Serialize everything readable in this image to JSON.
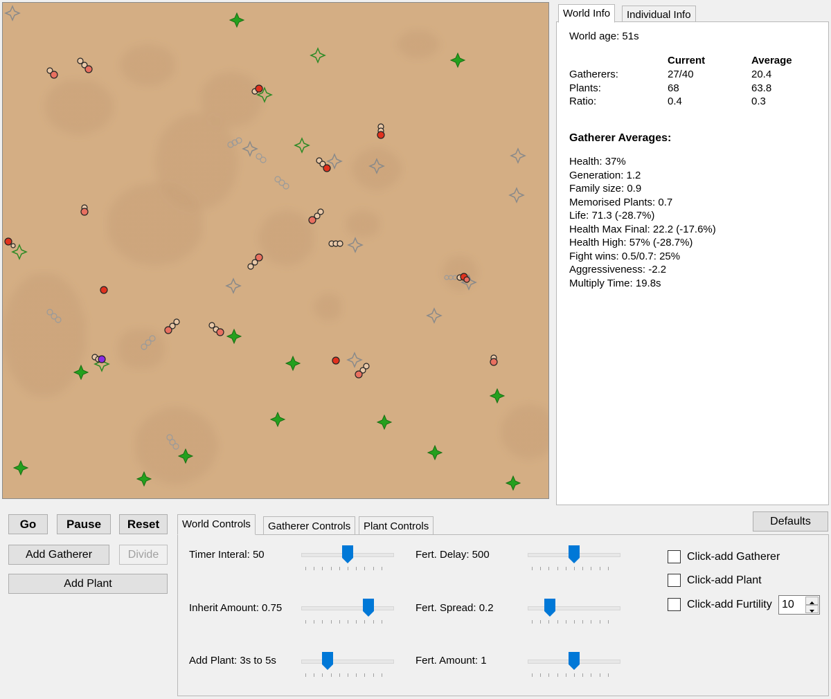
{
  "info_tabs": {
    "world": "World Info",
    "individual": "Individual Info"
  },
  "world_info": {
    "age": "World age: 51s",
    "col_current": "Current",
    "col_average": "Average",
    "rows": [
      {
        "label": "Gatherers:",
        "current": "27/40",
        "average": "20.4"
      },
      {
        "label": "Plants:",
        "current": "68",
        "average": "63.8"
      },
      {
        "label": "Ratio:",
        "current": "0.4",
        "average": "0.3"
      }
    ],
    "averages_title": "Gatherer Averages:",
    "averages": [
      "Health: 37%",
      "Generation: 1.2",
      "Family size: 0.9",
      "Memorised Plants: 0.7",
      "Life: 71.3 (-28.7%)",
      "Health Max Final: 22.2 (-17.6%)",
      "Health High: 57% (-28.7%)",
      "Fight wins: 0.5/0.7: 25%",
      "Aggressiveness: -2.2",
      "Multiply Time: 19.8s"
    ]
  },
  "buttons": {
    "go": "Go",
    "pause": "Pause",
    "reset": "Reset",
    "add_gatherer": "Add Gatherer",
    "divide": "Divide",
    "add_plant": "Add Plant",
    "defaults": "Defaults"
  },
  "control_tabs": {
    "world": "World Controls",
    "gatherer": "Gatherer Controls",
    "plant": "Plant Controls"
  },
  "sliders": [
    {
      "label": "Timer Interal: 50",
      "level": 0.5
    },
    {
      "label": "Fert. Delay: 500",
      "level": 0.5
    },
    {
      "label": "Inherit Amount: 0.75",
      "level": 0.75
    },
    {
      "label": "Fert. Spread: 0.2",
      "level": 0.2
    },
    {
      "label": "Add Plant: 3s to 5s",
      "level": 0.25
    },
    {
      "label": "Fert. Amount: 1",
      "level": 0.5
    }
  ],
  "checkboxes": [
    {
      "label": "Click-add Gatherer",
      "checked": false
    },
    {
      "label": "Click-add Plant",
      "checked": false
    },
    {
      "label": "Click-add Furtility",
      "checked": false
    }
  ],
  "furtility_value": "10",
  "colors": {
    "sand": "#d4ae84",
    "plant_green": "#24a01e",
    "gatherer_red": "#e0321e",
    "slider_blue": "#0078d7"
  }
}
